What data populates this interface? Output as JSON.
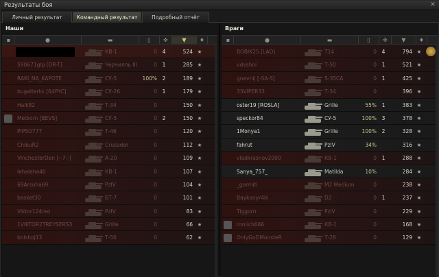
{
  "window": {
    "title": "Результаты боя"
  },
  "tabs": [
    {
      "label": "Личный результат"
    },
    {
      "label": "Командный результат"
    },
    {
      "label": "Подробный отчёт"
    }
  ],
  "left": {
    "title": "Наши",
    "rows": [
      {
        "name": "",
        "vehicle": "КВ-1",
        "pct": "0",
        "kills": "4",
        "exp": "524",
        "state": "me",
        "blank": true
      },
      {
        "name": "590671glp [DR-T]",
        "vehicle": "Черчилль III",
        "pct": "0",
        "kills": "1",
        "exp": "285",
        "state": "dead"
      },
      {
        "name": "RAKI_NA_KAPOTE",
        "vehicle": "СУ-5",
        "pct": "100%",
        "kills": "2",
        "exp": "189",
        "state": "dead"
      },
      {
        "name": "bugalterks [64PYC]",
        "vehicle": "СУ-26",
        "pct": "0",
        "kills": "1",
        "exp": "179",
        "state": "dead"
      },
      {
        "name": "Halk82",
        "vehicle": "Т-34",
        "pct": "0",
        "kills": "",
        "exp": "150",
        "state": "dead"
      },
      {
        "name": "Meiborn [BEVS]",
        "vehicle": "СУ-5",
        "pct": "0",
        "kills": "2",
        "exp": "150",
        "state": "dead",
        "flag": true
      },
      {
        "name": "PIPSO777",
        "vehicle": "Т-46",
        "pct": "0",
        "kills": "",
        "exp": "120",
        "state": "dead"
      },
      {
        "name": "ChibuR2",
        "vehicle": "Crusader",
        "pct": "0",
        "kills": "",
        "exp": "112",
        "state": "dead"
      },
      {
        "name": "VinchesterDen [--7--]",
        "vehicle": "А-20",
        "pct": "0",
        "kills": "",
        "exp": "109",
        "state": "dead"
      },
      {
        "name": "lehaleha40",
        "vehicle": "КВ-1",
        "pct": "0",
        "kills": "",
        "exp": "107",
        "state": "dead"
      },
      {
        "name": "69Arsuha69",
        "vehicle": "PzIV",
        "pct": "0",
        "kills": "",
        "exp": "104",
        "state": "dead"
      },
      {
        "name": "basket30",
        "vehicle": "БТ-7",
        "pct": "0",
        "kills": "",
        "exp": "101",
        "state": "dead"
      },
      {
        "name": "Viktor124reo",
        "vehicle": "PzIV",
        "pct": "0",
        "kills": "",
        "exp": "83",
        "state": "dead"
      },
      {
        "name": "1VIKTOR2TREYSERS3",
        "vehicle": "Grille",
        "pct": "0",
        "kills": "",
        "exp": "66",
        "state": "dead"
      },
      {
        "name": "bolshoj13",
        "vehicle": "Т-50",
        "pct": "0",
        "kills": "",
        "exp": "62",
        "state": "dead"
      }
    ]
  },
  "right": {
    "title": "Враги",
    "rows": [
      {
        "name": "BOBIK25 [LAO]",
        "vehicle": "T14",
        "pct": "0",
        "kills": "4",
        "exp": "794",
        "state": "dead",
        "medal": true
      },
      {
        "name": "vdvshni",
        "vehicle": "Т-50",
        "pct": "0",
        "kills": "1",
        "exp": "521",
        "state": "dead"
      },
      {
        "name": "gnevnij [-SA-S]",
        "vehicle": "S-35CA",
        "pct": "0",
        "kills": "1",
        "exp": "425",
        "state": "dead"
      },
      {
        "name": "33VIPER33",
        "vehicle": "Т-34",
        "pct": "0",
        "kills": "",
        "exp": "396",
        "state": "dead"
      },
      {
        "name": "oster19 [ROSLA]",
        "vehicle": "Grille",
        "pct": "55%",
        "kills": "1",
        "exp": "383",
        "state": "alive"
      },
      {
        "name": "speckor84",
        "vehicle": "СУ-5",
        "pct": "100%",
        "kills": "3",
        "exp": "378",
        "state": "alive"
      },
      {
        "name": "1Monya1",
        "vehicle": "Grille",
        "pct": "100%",
        "kills": "2",
        "exp": "328",
        "state": "alive"
      },
      {
        "name": "fahrut",
        "vehicle": "PzIV",
        "pct": "34%",
        "kills": "",
        "exp": "316",
        "state": "alive"
      },
      {
        "name": "vladkrasnov2000",
        "vehicle": "КВ-1",
        "pct": "0",
        "kills": "1",
        "exp": "288",
        "state": "dead"
      },
      {
        "name": "Sanya_757_",
        "vehicle": "Matilda",
        "pct": "10%",
        "kills": "",
        "exp": "284",
        "state": "alive"
      },
      {
        "name": "_gormiti",
        "vehicle": "M2 Medium",
        "pct": "0",
        "kills": "",
        "exp": "238",
        "state": "dead"
      },
      {
        "name": "Baykonyr4ik",
        "vehicle": "D2",
        "pct": "0",
        "kills": "1",
        "exp": "237",
        "state": "dead"
      },
      {
        "name": "Tiggorrr",
        "vehicle": "PzIV",
        "pct": "0",
        "kills": "",
        "exp": "229",
        "state": "dead"
      },
      {
        "name": "romich666",
        "vehicle": "КВ-1",
        "pct": "0",
        "kills": "",
        "exp": "168",
        "state": "dead",
        "flag": true
      },
      {
        "name": "OnlyGoDMonsteR",
        "vehicle": "Т-28",
        "pct": "0",
        "kills": "",
        "exp": "129",
        "state": "dead",
        "flag": true
      }
    ]
  },
  "icons": {
    "star": "★",
    "close": "✕",
    "sort": "▼"
  }
}
